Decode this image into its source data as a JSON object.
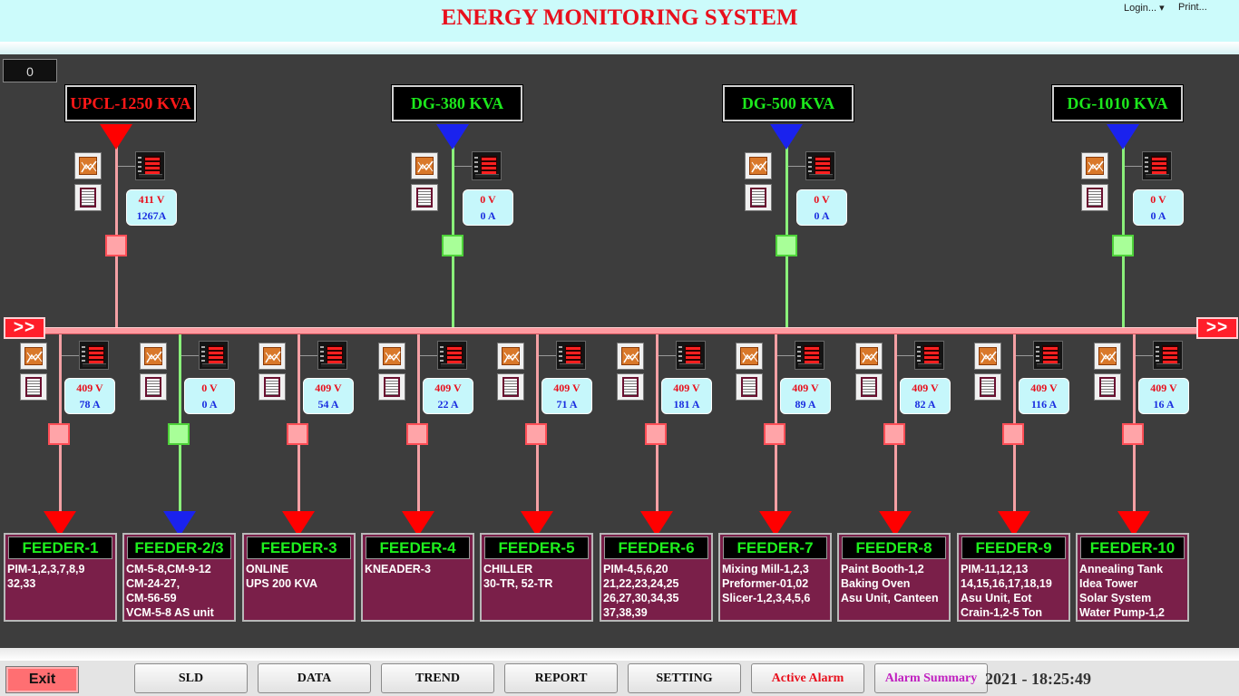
{
  "header": {
    "title": "ENERGY MONITORING SYSTEM",
    "login_label": "Login...",
    "print_label": "Print..."
  },
  "counter": "0",
  "colors": {
    "live": "#ff9aa0",
    "dead": "#8af07a",
    "title": "#e8101d",
    "feeder_bg": "#7a1f49"
  },
  "sources": [
    {
      "label": "UPCL-1250 KVA",
      "state": "live",
      "voltage": "411  V",
      "current": "1267A"
    },
    {
      "label": "DG-380 KVA",
      "state": "off",
      "voltage": "0   V",
      "current": "0    A"
    },
    {
      "label": "DG-500 KVA",
      "state": "off",
      "voltage": "0   V",
      "current": "0    A"
    },
    {
      "label": "DG-1010 KVA",
      "state": "off",
      "voltage": "0   V",
      "current": "0    A"
    }
  ],
  "bus": {
    "left_arrow": ">>",
    "right_arrow": ">>"
  },
  "feeders": [
    {
      "name": "FEEDER-1",
      "state": "live",
      "voltage": "409  V",
      "current": "78   A",
      "loads": [
        "PIM-1,2,3,7,8,9",
        "32,33"
      ]
    },
    {
      "name": "FEEDER-2/3",
      "state": "off",
      "voltage": "0    V",
      "current": "0    A",
      "loads": [
        "CM-5-8,CM-9-12",
        "CM-24-27,",
        "CM-56-59",
        "VCM-5-8 AS unit"
      ]
    },
    {
      "name": "FEEDER-3",
      "state": "live",
      "voltage": "409  V",
      "current": "54   A",
      "loads": [
        "ONLINE",
        "UPS 200 KVA"
      ]
    },
    {
      "name": "FEEDER-4",
      "state": "live",
      "voltage": "409  V",
      "current": "22   A",
      "loads": [
        "KNEADER-3"
      ]
    },
    {
      "name": "FEEDER-5",
      "state": "live",
      "voltage": "409  V",
      "current": "71   A",
      "loads": [
        "CHILLER",
        "30-TR, 52-TR"
      ]
    },
    {
      "name": "FEEDER-6",
      "state": "live",
      "voltage": "409  V",
      "current": "181  A",
      "loads": [
        "PIM-4,5,6,20",
        "21,22,23,24,25",
        "26,27,30,34,35",
        "37,38,39"
      ]
    },
    {
      "name": "FEEDER-7",
      "state": "live",
      "voltage": "409  V",
      "current": "89   A",
      "loads": [
        "Mixing Mill-1,2,3",
        "Preformer-01,02",
        "Slicer-1,2,3,4,5,6"
      ]
    },
    {
      "name": "FEEDER-8",
      "state": "live",
      "voltage": "409  V",
      "current": "82   A",
      "loads": [
        "Paint Booth-1,2",
        "Baking Oven",
        "Asu Unit, Canteen"
      ]
    },
    {
      "name": "FEEDER-9",
      "state": "live",
      "voltage": "409  V",
      "current": "116  A",
      "loads": [
        "PIM-11,12,13",
        "14,15,16,17,18,19",
        "Asu Unit, Eot",
        "Crain-1,2-5 Ton"
      ]
    },
    {
      "name": "FEEDER-10",
      "state": "live",
      "voltage": "409  V",
      "current": "16   A",
      "loads": [
        "Annealing Tank",
        "Idea Tower",
        "Solar System",
        "Water Pump-1,2"
      ]
    }
  ],
  "footer": {
    "exit_label": "Exit",
    "buttons": [
      {
        "label": "SLD",
        "color": "#111111"
      },
      {
        "label": "DATA",
        "color": "#111111"
      },
      {
        "label": "TREND",
        "color": "#111111"
      },
      {
        "label": "REPORT",
        "color": "#111111"
      },
      {
        "label": "SETTING",
        "color": "#111111"
      },
      {
        "label": "Active Alarm",
        "color": "#e8101d"
      },
      {
        "label": "Alarm Summary",
        "color": "#c020c0"
      }
    ],
    "datetime": "2021 - 18:25:49"
  }
}
